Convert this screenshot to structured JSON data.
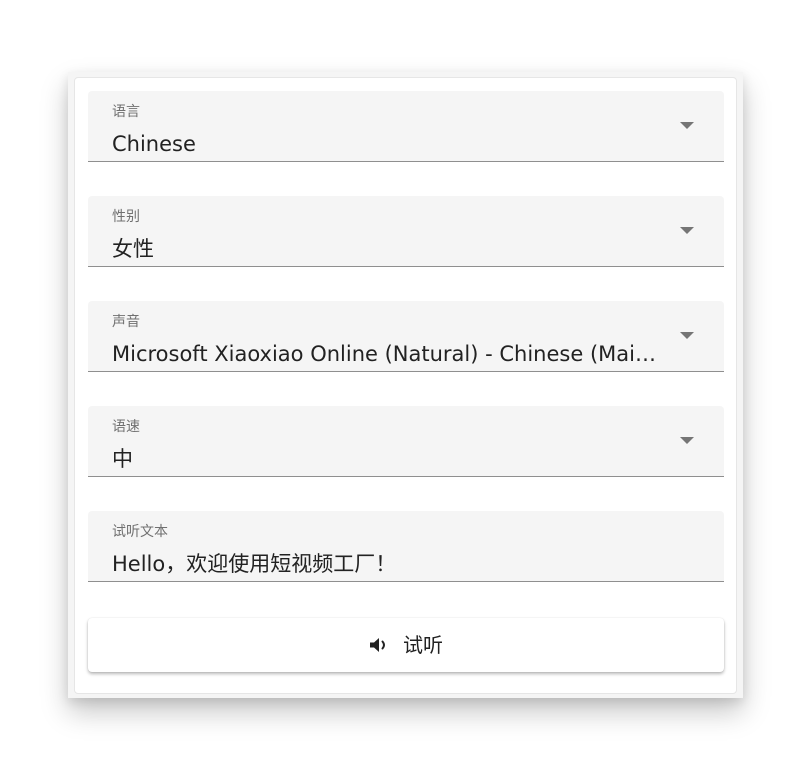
{
  "form": {
    "language": {
      "label": "语言",
      "value": "Chinese"
    },
    "gender": {
      "label": "性别",
      "value": "女性"
    },
    "voice": {
      "label": "声音",
      "value": "Microsoft Xiaoxiao Online (Natural) - Chinese (Mainland)"
    },
    "rate": {
      "label": "语速",
      "value": "中"
    },
    "sample_text": {
      "label": "试听文本",
      "value": "Hello，欢迎使用短视频工厂！"
    },
    "listen_button": {
      "label": "试听",
      "icon": "speaker-icon"
    }
  }
}
